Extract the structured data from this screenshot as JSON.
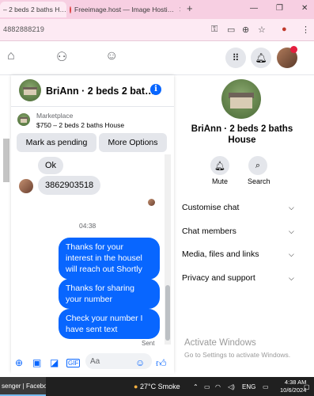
{
  "browser": {
    "tabs": [
      {
        "label": "– 2 beds 2 baths H…"
      },
      {
        "label": "Freeimage.host — Image Hosti…"
      }
    ],
    "new_tab": "+",
    "window_controls": [
      "—",
      "❐",
      "✕"
    ],
    "url": "4882888219"
  },
  "chat": {
    "title": "BriAnn · 2 beds 2 bat…",
    "marketplace_label": "Marketplace",
    "listing": "$750 – 2 beds 2 baths House",
    "mark_pending_label": "Mark as pending",
    "more_options_label": "More Options",
    "messages": [
      {
        "text": "Ok"
      },
      {
        "text": "3862903518"
      }
    ],
    "timestamp": "04:38",
    "outgoing": [
      {
        "text": "Thanks for your interest in the housel will reach out Shortly"
      },
      {
        "text": "Thanks  for  sharing your number"
      },
      {
        "text": "Check your number  I have  sent text"
      }
    ],
    "status": "Sent",
    "composer_placeholder": "Aa"
  },
  "side_panel": {
    "name": "BriAnn · 2 beds 2 baths House",
    "actions": [
      {
        "label": "Mute",
        "icon": "bell-icon"
      },
      {
        "label": "Search",
        "icon": "search-icon"
      }
    ],
    "sections": [
      {
        "label": "Customise chat"
      },
      {
        "label": "Chat members"
      },
      {
        "label": "Media, files and links"
      },
      {
        "label": "Privacy and support"
      }
    ]
  },
  "watermark": {
    "title": "Activate Windows",
    "subtitle": "Go to Settings to activate Windows."
  },
  "taskbar": {
    "app": "senger | Facebo…",
    "weather": "27°C  Smoke",
    "language": "ENG",
    "time": "4:38 AM",
    "date": "10/6/2024"
  },
  "colors": {
    "accent": "#0866ff",
    "tabstrip": "#f7cfe2",
    "taskbar": "#202020"
  }
}
